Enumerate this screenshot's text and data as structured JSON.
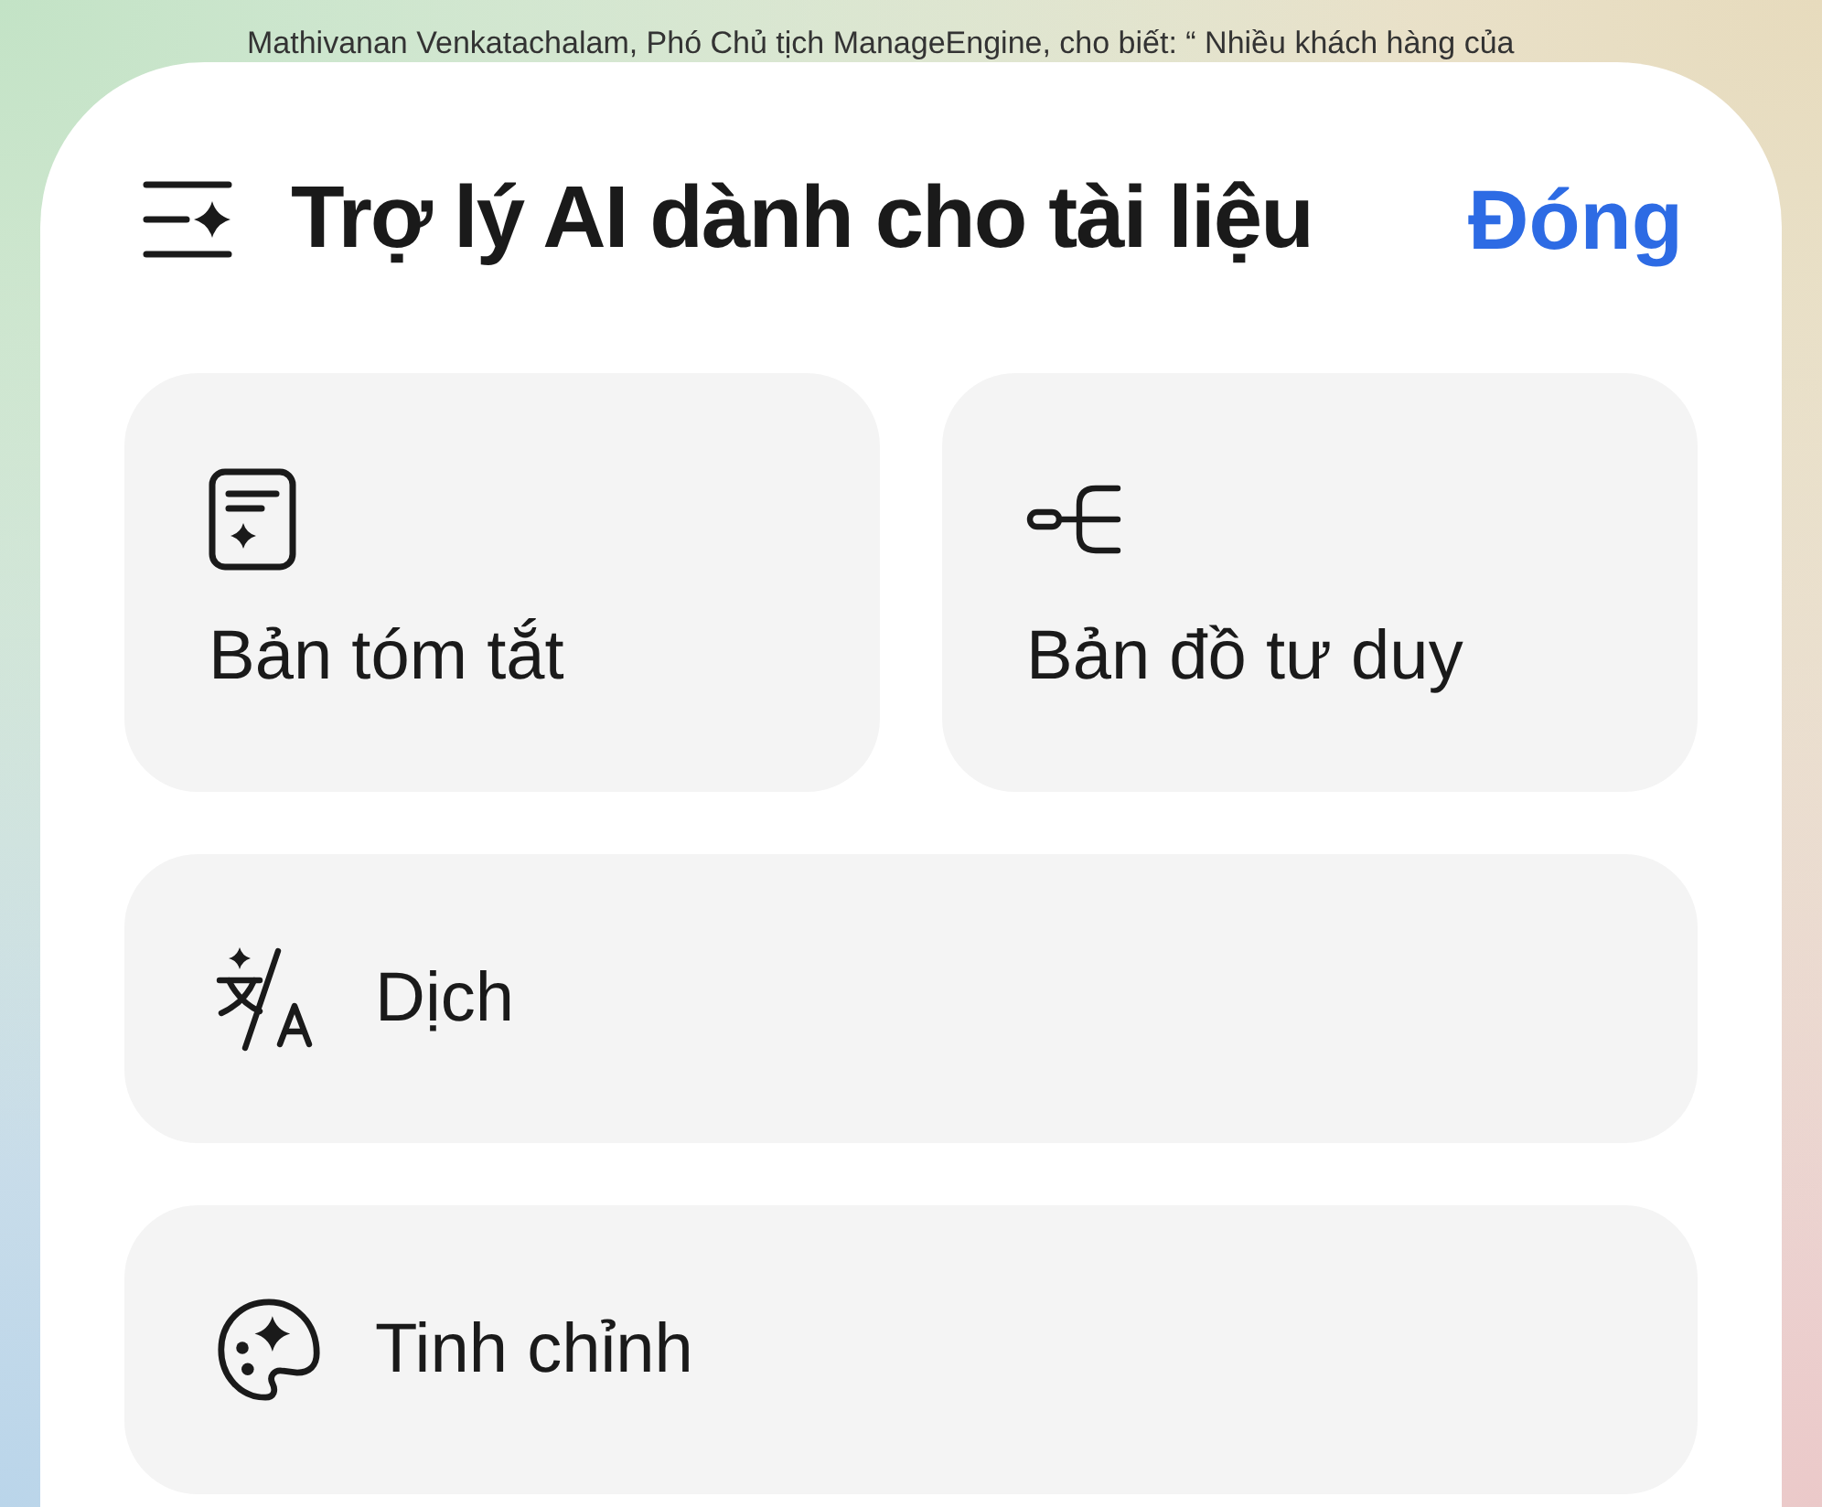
{
  "background_text": {
    "lines": [
      "Mathivanan Venkatachalam, Phó Chủ tịch ManageEngine, cho biết: “ Nhiều khách hàng của"
    ]
  },
  "sheet": {
    "title": "Trợ lý AI dành cho tài liệu",
    "close_button": "Đóng"
  },
  "actions": [
    {
      "kind": "tile",
      "label": "Bản tóm tắt"
    },
    {
      "kind": "tile",
      "label": "Bản đồ tư duy"
    },
    {
      "kind": "row",
      "label": "Dịch"
    },
    {
      "kind": "row",
      "label": "Tinh chỉnh"
    }
  ]
}
